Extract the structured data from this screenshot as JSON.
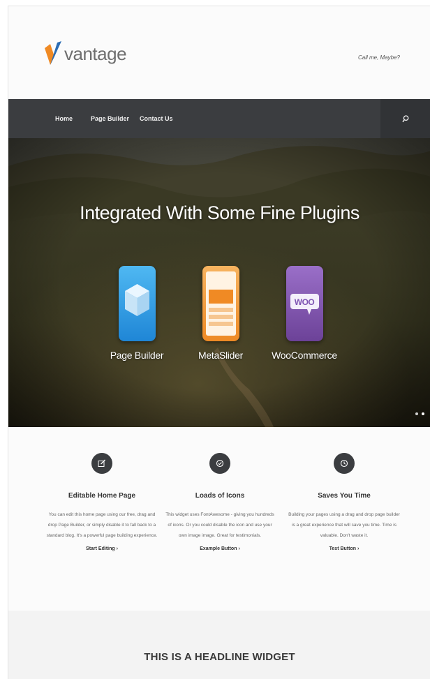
{
  "header": {
    "logo_text": "vantage",
    "tagline": "Call me, Maybe?"
  },
  "nav": {
    "items": [
      {
        "label": "Home"
      },
      {
        "label": "Page Builder"
      },
      {
        "label": "Contact Us"
      }
    ],
    "search_icon": "search-icon"
  },
  "hero": {
    "title": "Integrated With Some Fine Plugins",
    "plugins": [
      {
        "label": "Page Builder",
        "icon": "page-builder-icon",
        "color": "#2e9be6"
      },
      {
        "label": "MetaSlider",
        "icon": "metaslider-icon",
        "color": "#f0922b"
      },
      {
        "label": "WooCommerce",
        "icon": "woocommerce-icon",
        "color": "#7f54b3",
        "badge": "WOO"
      }
    ],
    "slide_count": 2,
    "active_slide": 1
  },
  "features": [
    {
      "icon": "edit-icon",
      "title": "Editable Home Page",
      "text": "You can edit this home page using our free, drag and drop Page Builder, or simply disable it to fall back to a standard blog. It's a powerful page building experience.",
      "link": "Start Editing"
    },
    {
      "icon": "check-circle-icon",
      "title": "Loads of Icons",
      "text": "This widget uses FontAwesome - giving you hundreds of icons. Or you could disable the icon and use your own image image. Great for testimonials.",
      "link": "Example Button"
    },
    {
      "icon": "clock-icon",
      "title": "Saves You Time",
      "text": "Building your pages using a drag and drop page builder is a great experience that will save you time. Time is valuable. Don't waste it.",
      "link": "Test Button"
    }
  ],
  "headline_widget": {
    "text": "THIS IS A HEADLINE WIDGET"
  },
  "colors": {
    "nav_bg": "#3b3d40",
    "accent_orange": "#f08a24",
    "accent_blue": "#2b6cb3"
  }
}
